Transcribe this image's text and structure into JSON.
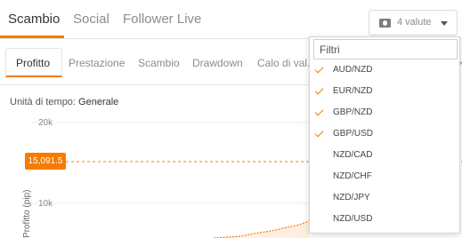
{
  "top_tabs": [
    {
      "label": "Scambio",
      "active": true
    },
    {
      "label": "Social",
      "active": false
    },
    {
      "label": "Follower Live",
      "active": false
    }
  ],
  "currency_button": {
    "label": "4 valute",
    "icon": "cash-icon"
  },
  "sub_tabs": [
    {
      "label": "Profitto",
      "active": true
    },
    {
      "label": "Prestazione",
      "active": false
    },
    {
      "label": "Scambio",
      "active": false
    },
    {
      "label": "Drawdown",
      "active": false
    },
    {
      "label": "Calo di val.",
      "active": false
    }
  ],
  "time_unit": {
    "label": "Unità di tempo:",
    "value": "Generale"
  },
  "chart": {
    "ylabel": "Profitto (pip)",
    "ytick_labels": [
      "20k",
      "10k"
    ],
    "current_value_badge": "15,091.5",
    "accent_color": "#f57c00"
  },
  "chart_data": {
    "type": "area",
    "ylabel": "Profitto (pip)",
    "ylim": [
      0,
      20000
    ],
    "yticks": [
      20000,
      10000
    ],
    "current_value": 15091.5,
    "grid": true
  },
  "dropdown": {
    "filter_placeholder": "Filtri",
    "options": [
      {
        "label": "AUD/NZD",
        "checked": true
      },
      {
        "label": "EUR/NZD",
        "checked": true
      },
      {
        "label": "GBP/NZD",
        "checked": true
      },
      {
        "label": "GBP/USD",
        "checked": true
      },
      {
        "label": "NZD/CAD",
        "checked": false
      },
      {
        "label": "NZD/CHF",
        "checked": false
      },
      {
        "label": "NZD/JPY",
        "checked": false
      },
      {
        "label": "NZD/USD",
        "checked": false
      }
    ]
  }
}
